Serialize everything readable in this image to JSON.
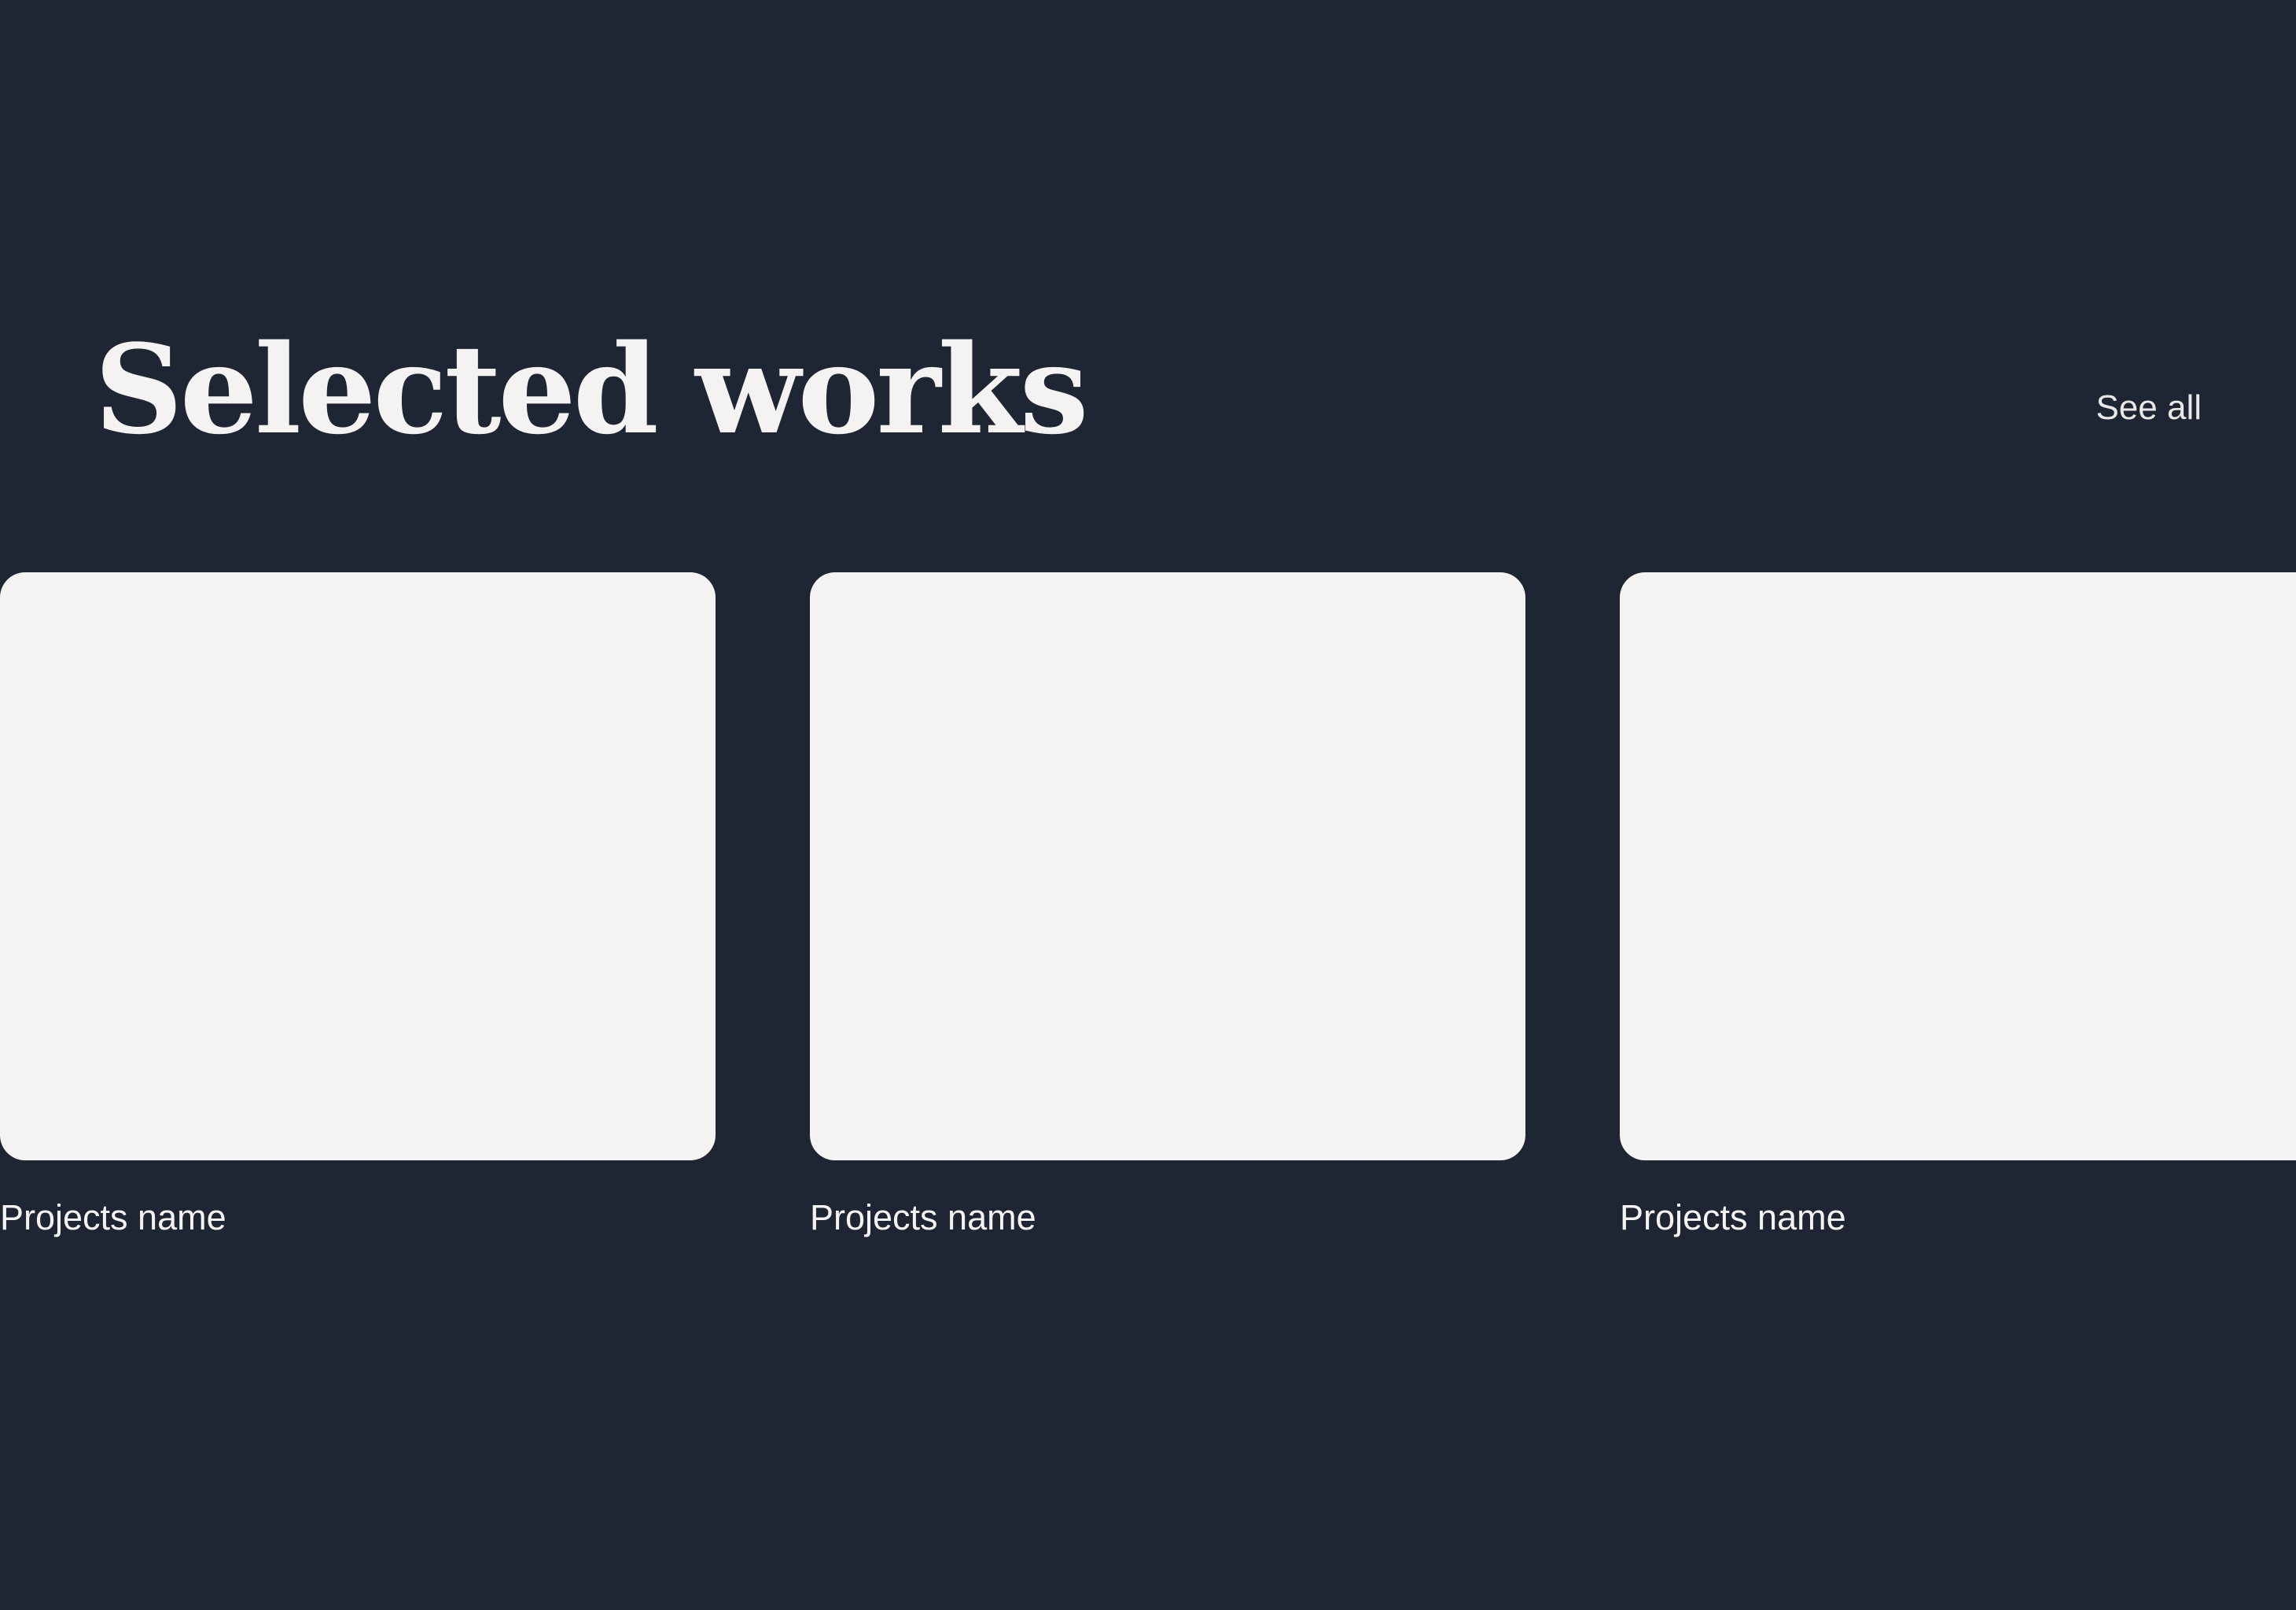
{
  "section": {
    "title": "Selected works",
    "see_all_label": "See all"
  },
  "projects": [
    {
      "name": "Projects name"
    },
    {
      "name": "Projects name"
    },
    {
      "name": "Projects name"
    }
  ],
  "colors": {
    "background": "#1f2633",
    "card": "#f4f3f1",
    "text": "#f4f3f1"
  }
}
